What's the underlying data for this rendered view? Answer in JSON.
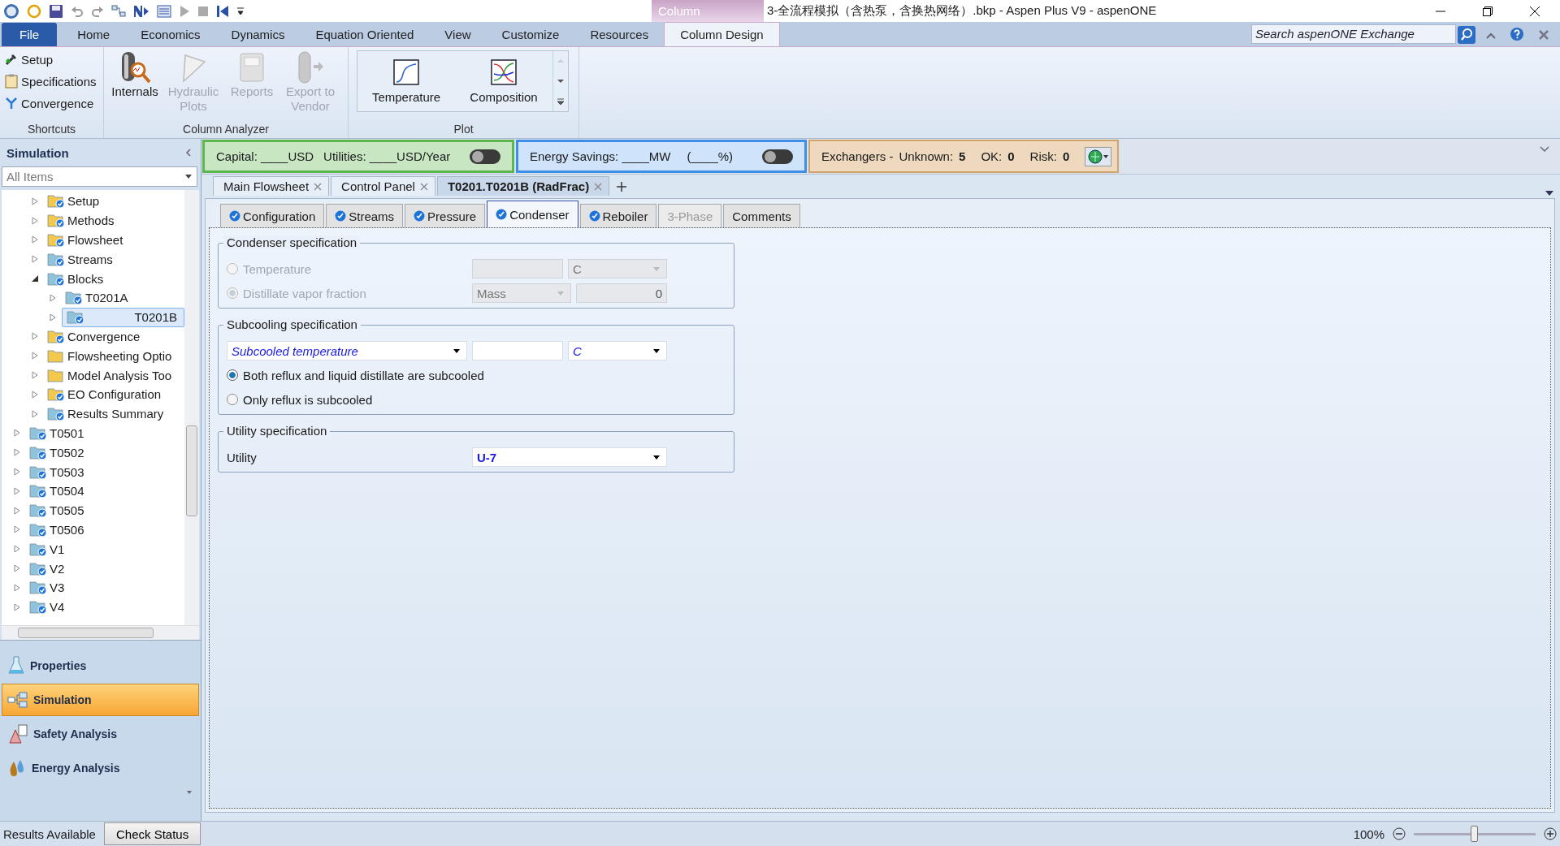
{
  "window": {
    "title": "3-全流程模拟（含热泵，含换热网络）.bkp - Aspen Plus V9 - aspenONE",
    "context_tab": "Column"
  },
  "ribbon_tabs": [
    {
      "label": "File",
      "kind": "file",
      "selected": false
    },
    {
      "label": "Home",
      "kind": "tab",
      "selected": false
    },
    {
      "label": "Economics",
      "kind": "tab",
      "selected": false
    },
    {
      "label": "Dynamics",
      "kind": "tab",
      "selected": false
    },
    {
      "label": "Equation Oriented",
      "kind": "tab",
      "selected": false
    },
    {
      "label": "View",
      "kind": "tab",
      "selected": false
    },
    {
      "label": "Customize",
      "kind": "tab",
      "selected": false
    },
    {
      "label": "Resources",
      "kind": "tab",
      "selected": false
    },
    {
      "label": "Column Design",
      "kind": "tab",
      "selected": true
    }
  ],
  "search": {
    "placeholder": "Search aspenONE Exchange"
  },
  "ribbon_groups": [
    {
      "label": "Shortcuts",
      "kind": "list",
      "items": [
        {
          "label": "Setup",
          "disabled": false
        },
        {
          "label": "Specifications",
          "disabled": false
        },
        {
          "label": "Convergence",
          "disabled": false
        }
      ]
    },
    {
      "label": "Column Analyzer",
      "kind": "large",
      "items": [
        {
          "label": "Internals",
          "disabled": false
        },
        {
          "label": "Hydraulic Plots",
          "disabled": true
        },
        {
          "label": "Reports",
          "disabled": true
        },
        {
          "label": "Export to Vendor",
          "disabled": true
        }
      ]
    },
    {
      "label": "Plot",
      "kind": "gallery",
      "items": [
        {
          "label": "Temperature",
          "disabled": false
        },
        {
          "label": "Composition",
          "disabled": false
        }
      ]
    }
  ],
  "sidebar": {
    "title": "Simulation",
    "filter": "All Items",
    "tree": [
      {
        "children": [
          {
            "label": "Setup",
            "kind": "folder",
            "checked": true,
            "expanded": false,
            "selected": false
          },
          {
            "label": "Methods",
            "kind": "folder",
            "checked": true,
            "expanded": false,
            "selected": false
          },
          {
            "label": "Flowsheet",
            "kind": "folder",
            "checked": true,
            "expanded": false,
            "selected": false
          },
          {
            "label": "Streams",
            "kind": "object",
            "checked": true,
            "expanded": false,
            "selected": false
          },
          {
            "label": "Blocks",
            "kind": "object",
            "checked": true,
            "expanded": true,
            "selected": false,
            "children": [
              {
                "label": "T0201A",
                "kind": "object",
                "checked": true,
                "expanded": false,
                "selected": false
              },
              {
                "label": "T0201B",
                "kind": "object",
                "checked": true,
                "expanded": false,
                "selected": true
              }
            ]
          },
          {
            "label": "Convergence",
            "kind": "folder",
            "checked": true,
            "expanded": false,
            "selected": false
          },
          {
            "label": "Flowsheeting Optio",
            "kind": "folder",
            "checked": false,
            "expanded": false,
            "selected": false
          },
          {
            "label": "Model Analysis Too",
            "kind": "folder",
            "checked": false,
            "expanded": false,
            "selected": false
          },
          {
            "label": "EO Configuration",
            "kind": "folder",
            "checked": true,
            "expanded": false,
            "selected": false
          },
          {
            "label": "Results Summary",
            "kind": "object",
            "checked": true,
            "expanded": false,
            "selected": false
          }
        ]
      },
      {
        "label": "T0501",
        "kind": "object",
        "checked": true,
        "expanded": false,
        "selected": false
      },
      {
        "label": "T0502",
        "kind": "object",
        "checked": true,
        "expanded": false,
        "selected": false
      },
      {
        "label": "T0503",
        "kind": "object",
        "checked": true,
        "expanded": false,
        "selected": false
      },
      {
        "label": "T0504",
        "kind": "object",
        "checked": true,
        "expanded": false,
        "selected": false
      },
      {
        "label": "T0505",
        "kind": "object",
        "checked": true,
        "expanded": false,
        "selected": false
      },
      {
        "label": "T0506",
        "kind": "object",
        "checked": true,
        "expanded": false,
        "selected": false
      },
      {
        "label": "V1",
        "kind": "object",
        "checked": true,
        "expanded": false,
        "selected": false
      },
      {
        "label": "V2",
        "kind": "object",
        "checked": true,
        "expanded": false,
        "selected": false
      },
      {
        "label": "V3",
        "kind": "object",
        "checked": true,
        "expanded": false,
        "selected": false
      },
      {
        "label": "V4",
        "kind": "object",
        "checked": true,
        "expanded": false,
        "selected": false
      }
    ]
  },
  "nav_panes": [
    {
      "label": "Properties",
      "selected": false
    },
    {
      "label": "Simulation",
      "selected": true
    },
    {
      "label": "Safety Analysis",
      "selected": false
    },
    {
      "label": "Energy Analysis",
      "selected": false
    }
  ],
  "info_bar": {
    "cost": {
      "texts": [
        "Capital: ____USD",
        "Utilities: ____USD/Year"
      ],
      "on": false
    },
    "energy": {
      "texts": [
        "Energy Savings: ____MW",
        "(____%)"
      ],
      "on": false
    },
    "exchangers": {
      "label": "Exchangers -",
      "counts": [
        {
          "label": "Unknown:",
          "value": "5"
        },
        {
          "label": "OK:",
          "value": "0"
        },
        {
          "label": "Risk:",
          "value": "0"
        }
      ]
    }
  },
  "doc_tabs": [
    {
      "label": "Main Flowsheet",
      "selected": false
    },
    {
      "label": "Control Panel",
      "selected": false
    },
    {
      "label": "T0201.T0201B (RadFrac)",
      "selected": true
    }
  ],
  "form_tabs": [
    {
      "label": "Configuration",
      "checked": true,
      "disabled": false,
      "selected": false
    },
    {
      "label": "Streams",
      "checked": true,
      "disabled": false,
      "selected": false
    },
    {
      "label": "Pressure",
      "checked": true,
      "disabled": false,
      "selected": false
    },
    {
      "label": "Condenser",
      "checked": true,
      "disabled": false,
      "selected": true
    },
    {
      "label": "Reboiler",
      "checked": true,
      "disabled": false,
      "selected": false
    },
    {
      "label": "3-Phase",
      "checked": false,
      "disabled": true,
      "selected": false
    },
    {
      "label": "Comments",
      "checked": false,
      "disabled": false,
      "selected": false
    }
  ],
  "condenser_spec": {
    "title": "Condenser specification",
    "options": [
      {
        "label": "Temperature",
        "selected": false,
        "disabled": true,
        "fields": [
          {
            "kind": "input"
          },
          {
            "kind": "select",
            "value": "C"
          }
        ]
      },
      {
        "label": "Distillate vapor fraction",
        "selected": true,
        "disabled": true,
        "fields": [
          {
            "kind": "select",
            "value": "Mass"
          },
          {
            "kind": "input",
            "value": "0"
          }
        ]
      }
    ]
  },
  "subcooling_spec": {
    "title": "Subcooling specification",
    "type": "Subcooled temperature",
    "unit": "C",
    "options": [
      {
        "label": "Both reflux and liquid distillate are subcooled",
        "selected": true
      },
      {
        "label": "Only reflux is subcooled",
        "selected": false
      }
    ]
  },
  "utility_spec": {
    "title": "Utility specification",
    "label": "Utility",
    "value": "U-7"
  },
  "status_bar": {
    "text": "Results Available",
    "button": "Check Status",
    "zoom": "100%",
    "level": 0.5
  }
}
